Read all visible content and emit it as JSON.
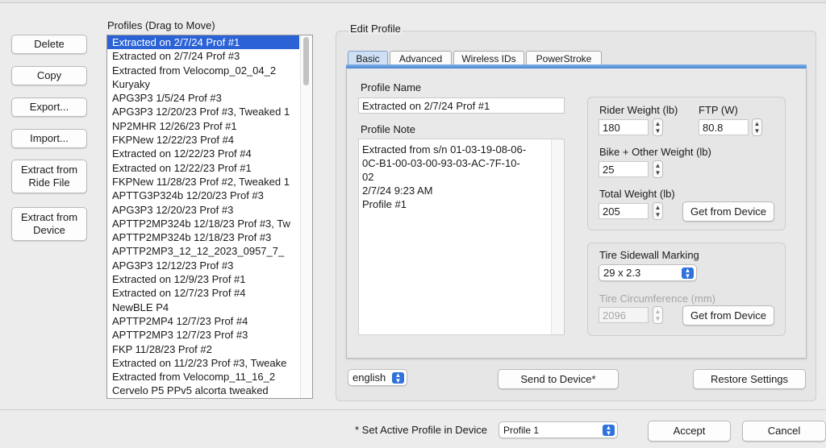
{
  "left_buttons": {
    "delete": "Delete",
    "copy": "Copy",
    "export": "Export...",
    "import": "Import...",
    "extract_ride_line1": "Extract from",
    "extract_ride_line2": "Ride File",
    "extract_device_line1": "Extract from",
    "extract_device_line2": "Device"
  },
  "profiles": {
    "header": "Profiles (Drag to Move)",
    "items": [
      "Extracted on 2/7/24 Prof #1",
      "Extracted on 2/7/24 Prof #3",
      "Extracted from Velocomp_02_04_2",
      "Kuryaky",
      "APG3P3 1/5/24 Prof #3",
      "APG3P3 12/20/23 Prof #3, Tweaked 1",
      "NP2MHR 12/26/23 Prof #1",
      "FKPNew 12/22/23 Prof #4",
      "Extracted on 12/22/23 Prof #4",
      "Extracted on 12/22/23 Prof #1",
      "FKPNew 11/28/23 Prof #2, Tweaked 1",
      "APTTG3P324b 12/20/23 Prof #3",
      "APG3P3 12/20/23 Prof #3",
      "APTTP2MP324b 12/18/23 Prof #3, Tw",
      "APTTP2MP324b 12/18/23 Prof #3",
      " APTTP2MP3_12_12_2023_0957_7_",
      "APG3P3 12/12/23 Prof #3",
      "Extracted on 12/9/23 Prof #1",
      "Extracted on 12/7/23 Prof #4",
      "NewBLE P4",
      "APTTP2MP4 12/7/23 Prof #4",
      "APTTP2MP3 12/7/23 Prof #3",
      "FKP 11/28/23 Prof #2",
      "Extracted on 11/2/23 Prof #3, Tweake",
      "Extracted from Velocomp_11_16_2",
      "Cervelo P5 PPv5 alcorta tweaked"
    ]
  },
  "edit_profile": {
    "title": "Edit Profile",
    "tabs": [
      "Basic",
      "Advanced",
      "Wireless IDs",
      "PowerStroke"
    ],
    "profile_name_label": "Profile Name",
    "profile_name_value": "Extracted on 2/7/24 Prof #1",
    "profile_note_label": "Profile Note",
    "profile_note_value": "Extracted from s/n 01-03-19-08-06-\n0C-B1-00-03-00-93-03-AC-7F-10-\n02\n2/7/24 9:23 AM\nProfile #1",
    "rider_weight_label": "Rider Weight (lb)",
    "rider_weight_value": "180",
    "ftp_label": "FTP (W)",
    "ftp_value": "80.8",
    "bike_weight_label": "Bike + Other Weight (lb)",
    "bike_weight_value": "25",
    "total_weight_label": "Total Weight (lb)",
    "total_weight_value": "205",
    "get_from_device": "Get from Device",
    "tire_marking_label": "Tire Sidewall Marking",
    "tire_marking_value": "29 x 2.3",
    "tire_circ_label": "Tire Circumference (mm)",
    "tire_circ_value": "2096"
  },
  "footer": {
    "language": "english",
    "send_to_device": "Send to Device*",
    "restore_settings": "Restore Settings",
    "active_profile_label": "* Set Active Profile in Device",
    "active_profile_value": "Profile 1",
    "accept": "Accept",
    "cancel": "Cancel"
  },
  "colors": {
    "selection": "#2b63d6",
    "accent": "#2f72dc"
  }
}
